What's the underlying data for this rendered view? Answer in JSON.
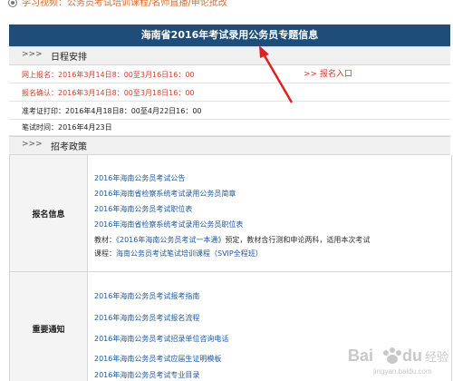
{
  "top": {
    "text": "学习视频：公务员考试培训课程/名师直播/申论批改"
  },
  "banner": {
    "title": "海南省2016年考试录用公务员专题信息"
  },
  "schedule": {
    "arrows": ">>>",
    "title": "日程安排",
    "rows": [
      "网上报名：2016年3月14日8：00至3月16日16：00",
      "报名确认：2016年3月14日8：00至3月18日16：00",
      "准考证打印：2016年4月18日8：00至4月22日16：00",
      "笔试时间：2016年4月23日"
    ],
    "signup": ">>  报名入口"
  },
  "policy": {
    "arrows": ">>>",
    "title": "招考政策"
  },
  "registration": {
    "label": "报名信息",
    "links": [
      "2016年海南公务员考试公告",
      "2016年海南省检察系统考试录用公务员简章",
      "2016年海南公务员考试职位表",
      "2016年海南省检察系统考试录用公务员职位表"
    ],
    "textbook_prefix": "教材：",
    "textbook_link": "《2016年海南公务员考试一本通》",
    "textbook_suffix": "预定，教材含行测和申论两科，适用本次考试",
    "course_prefix": "课程：",
    "course_link": "海南公务员考试笔试培训课程（SVIP全程班）"
  },
  "notices": {
    "label": "重要通知",
    "links": [
      "2016年海南公务员考试报考指南",
      "2016年海南公务员考试报名流程",
      "2016年海南公务员考试招录单位咨询电话",
      "2016年海南公务员考试应届生证明模板",
      "2016年海南公务员考试专业目录"
    ]
  },
  "watermark": {
    "text": "Bai du 经验",
    "url": "jingyan.baidu.com"
  },
  "colors": {
    "banner_bg": "#1f4d7a",
    "link": "#1d5aa6",
    "accent_red": "#d63b2a",
    "arrow": "#e02020"
  }
}
